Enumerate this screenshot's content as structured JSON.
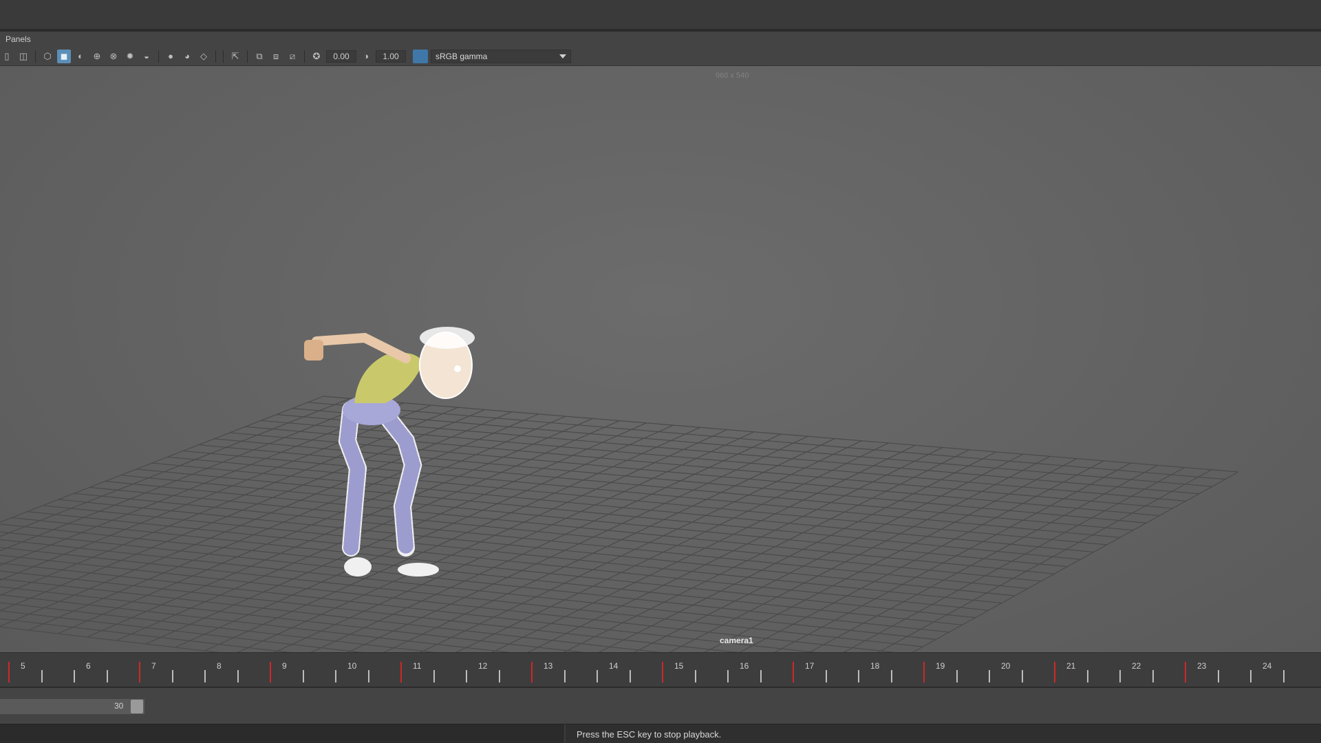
{
  "menubar": {
    "panels_label": "Panels"
  },
  "toolbar": {
    "exposure_value": "0.00",
    "gamma_value": "1.00",
    "color_management": "sRGB gamma",
    "icons": [
      "single-view-icon",
      "layout-icon",
      "wireframe-icon",
      "smooth-shade-icon",
      "shade-lighting-icon",
      "wireframe-on-shaded-icon",
      "xray-icon",
      "lights-icon",
      "shadows-icon",
      "ambient-occlusion-icon",
      "motion-blur-icon",
      "antialiasing-icon",
      "select-camera-icon",
      "isolate-icon",
      "frame-all-icon",
      "frame-selection-icon",
      "exposure-icon",
      "gamma-icon"
    ],
    "accent_color": "#5b8fb8"
  },
  "viewport": {
    "resolution_gate": "960 x 540",
    "camera_label": "camera1"
  },
  "timeline": {
    "frames": [
      "5",
      "6",
      "7",
      "8",
      "9",
      "10",
      "11",
      "12",
      "13",
      "14",
      "15",
      "16",
      "17",
      "18",
      "19",
      "20",
      "21",
      "22",
      "23",
      "24"
    ],
    "keyframes": [
      "5",
      "7",
      "9",
      "11",
      "13",
      "15",
      "17",
      "19",
      "21",
      "23"
    ],
    "key_color": "#d02828"
  },
  "range": {
    "end_value": "30"
  },
  "helpline": {
    "message": "Press the ESC key to stop playback."
  }
}
